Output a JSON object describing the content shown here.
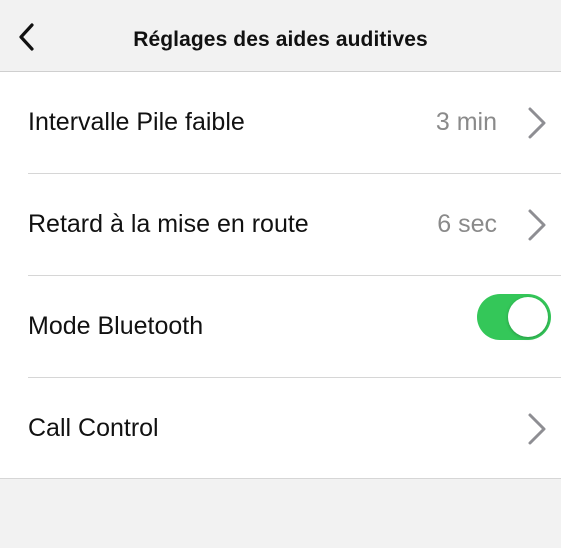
{
  "header": {
    "title": "Réglages des aides auditives",
    "back_icon": "chevron-left-icon"
  },
  "settings": {
    "rows": [
      {
        "label": "Intervalle Pile faible",
        "value": "3 min",
        "icon": "chevron-right-icon"
      },
      {
        "label": "Retard à la mise en route",
        "value": "6 sec",
        "icon": "chevron-right-icon"
      },
      {
        "label": "Mode Bluetooth",
        "toggle_on": true
      },
      {
        "label": "Call Control",
        "icon": "chevron-right-icon"
      }
    ]
  },
  "colors": {
    "toggle_on": "#34c759",
    "background": "#f2f2f2",
    "list_background": "#ffffff",
    "value_text": "#8a8a8a",
    "chevron": "#8e8e93"
  }
}
